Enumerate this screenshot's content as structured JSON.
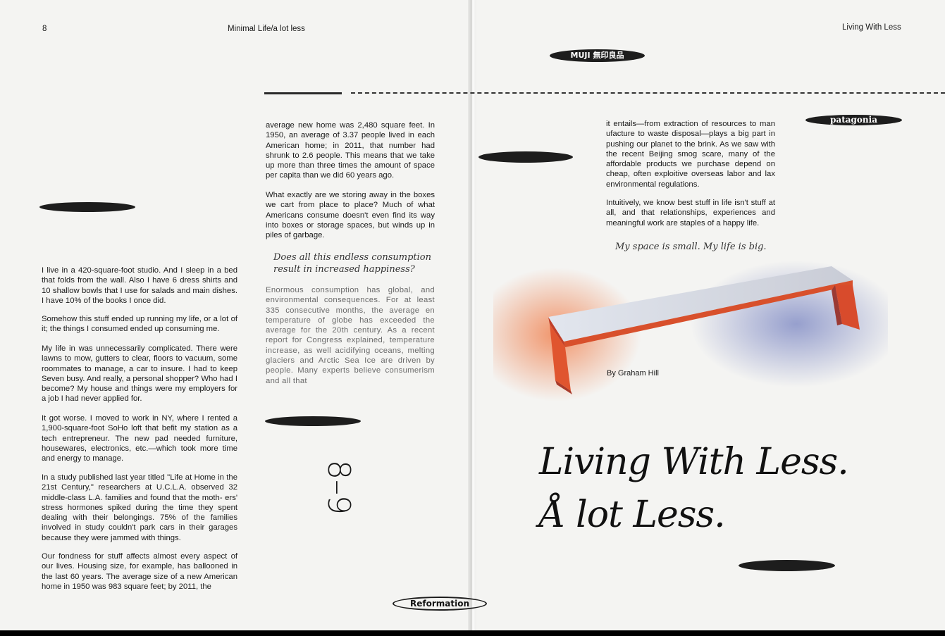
{
  "header": {
    "page_number": "8",
    "left_title": "Minimal Life/a lot less",
    "right_title": "Living With Less"
  },
  "logos": {
    "muji": "MUJI 無印良品",
    "patagonia": "patagonia",
    "reformation": "Reformation"
  },
  "left_column": [
    "I live in a 420-square-foot studio. And I sleep in a bed that folds from the wall. Also I have 6 dress shirts and 10 shallow bowls that I use for salads and main dishes. I have 10% of the books I once did.",
    "Somehow this stuff ended up running my life, or a lot of it; the things I consumed ended up consuming me.",
    "My life in was unnecessarily complicated. There were lawns to mow, gutters to clear, floors to vacuum, some roommates to manage, a car to insure. I had to keep Seven busy. And really, a personal shopper? Who had I become? My house and things were my employers for a job I had never applied for.",
    "It got worse. I moved to work in NY, where I rented a 1,900-square-foot SoHo loft that befit my station as a tech entrepreneur. The new pad needed furniture, housewares, electronics, etc.—which took more time and energy to manage.",
    "In a study published last year titled \"Life at Home in the 21st Century,\" researchers at U.C.L.A. observed 32 middle-class L.A. families and found that the moth- ers' stress hormones spiked during the time they spent dealing with their belongings. 75% of the families involved in study couldn't park cars in their garages because they were jammed with things.",
    "Our fondness for stuff affects almost every aspect of our lives. Housing size, for example, has ballooned in the last 60 years. The average size of a new American home in 1950 was 983 square feet; by 2011, the"
  ],
  "middle_column": [
    "average new home was 2,480 square feet. In 1950, an average of 3.37 people lived in each American home; in 2011, that number had shrunk to 2.6 people. This means that we take up more than three times the amount of space per capita than we did 60 years ago.",
    "What exactly are we storing away in the boxes we cart from place to place? Much of what Americans consume doesn't even find its way into boxes or storage spaces, but winds up in piles of garbage.",
    "Enormous consumption has global, and environmental consequences. For at least 335 consecutive months, the average en temperature of globe has exceeded the average for the 20th century. As a recent report for Congress explained, temperature increase, as well acidifying oceans, melting glaciers and Arctic Sea Ice are driven by people. Many experts believe consumerism and all that"
  ],
  "middle_quote": "Does all this endless consumption result in increased happiness?",
  "page_range": "8–9",
  "right_column": [
    "it entails—from extraction of resources to man ufacture to waste disposal—plays a big part in pushing our planet to the brink. As we saw with the recent Beijing smog scare, many of the affordable products we purchase depend on cheap, often exploitive overseas labor and lax environmental regulations.",
    "Intuitively, we know best stuff in life isn't stuff at all, and that relationships, experiences and meaningful work are staples of a happy life."
  ],
  "right_quote": "My space is small. My life is big.",
  "byline": "By Graham Hill",
  "headline": [
    "Living With Less.",
    "Å lot Less."
  ],
  "colors": {
    "paper": "#f4f4f2",
    "ink": "#1a1a1a",
    "bench_orange": "#e0522e",
    "bench_white": "#e4e6ea",
    "glow_blue": "#8a94c8"
  }
}
